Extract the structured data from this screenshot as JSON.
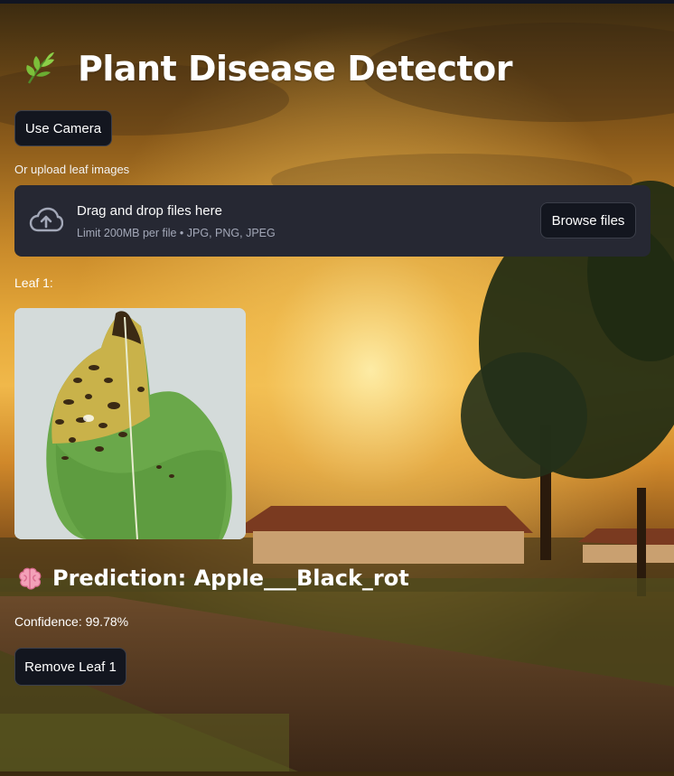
{
  "app": {
    "title": "Plant Disease Detector",
    "title_icon": "herb-leaf-icon"
  },
  "camera": {
    "button_label": "Use Camera"
  },
  "upload": {
    "label": "Or upload leaf images",
    "drop_title": "Drag and drop files here",
    "drop_limit": "Limit 200MB per file • JPG, PNG, JPEG",
    "browse_label": "Browse files",
    "icon": "cloud-upload-icon"
  },
  "results": [
    {
      "leaf_label": "Leaf 1:",
      "prediction_icon": "brain-icon",
      "prediction_text": "Prediction: Apple___Black_rot",
      "confidence_text": "Confidence: 99.78%",
      "remove_label": "Remove Leaf 1"
    }
  ],
  "colors": {
    "button_bg": "#13161f",
    "uploader_bg": "#262833",
    "text": "#ffffff",
    "muted_text": "#a3a8b8"
  }
}
